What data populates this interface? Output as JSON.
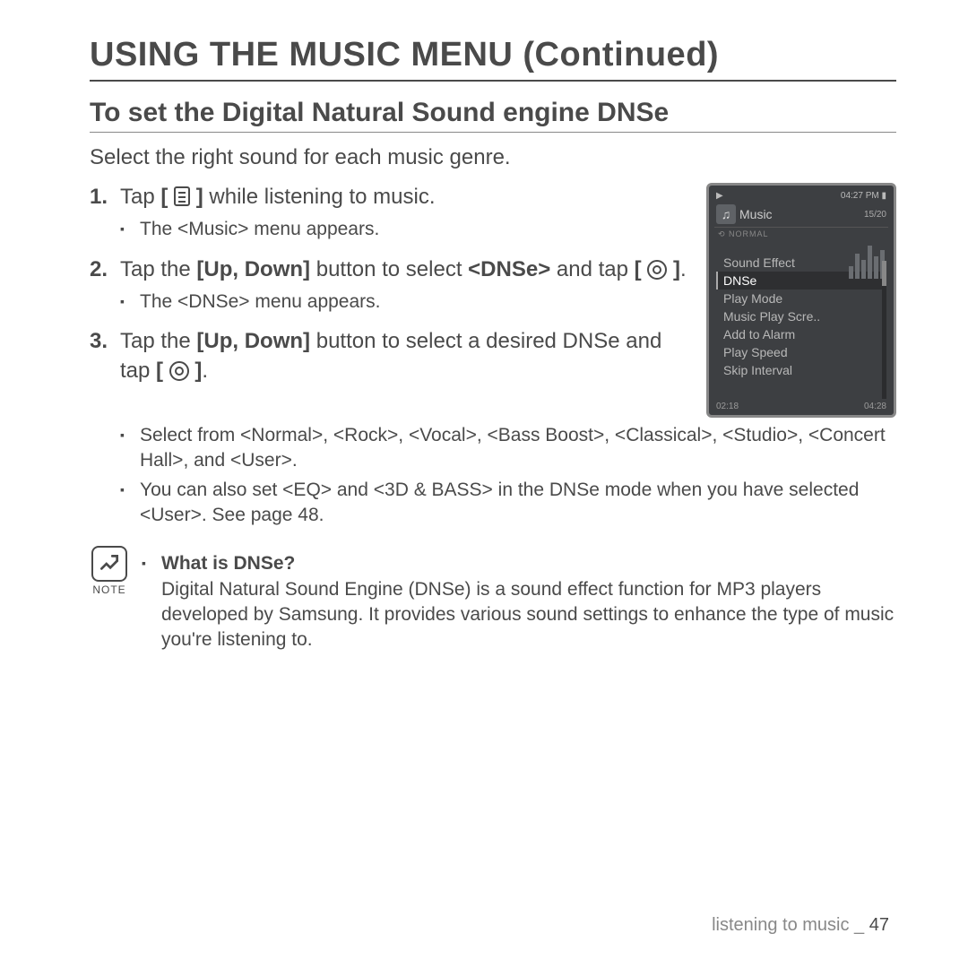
{
  "page_title": "USING THE MUSIC MENU (Continued)",
  "section_title": "To set the Digital Natural Sound engine DNSe",
  "intro": "Select the right sound for each music genre.",
  "steps": [
    {
      "pre": "Tap ",
      "icon": "menu",
      "post": " while listening to music.",
      "subs": [
        "The <Music> menu appears."
      ]
    },
    {
      "pre": "Tap the ",
      "bold1": "[Up, Down]",
      "mid": " button to select ",
      "bold2": "<DNSe>",
      "post2": " and tap ",
      "icon": "select",
      "post3": ".",
      "subs": [
        "The <DNSe> menu appears."
      ]
    },
    {
      "pre": "Tap the ",
      "bold1": "[Up, Down]",
      "mid": " button to select a desired DNSe and tap ",
      "icon": "select",
      "post3": ".",
      "subs": [
        "Select from <Normal>, <Rock>, <Vocal>, <Bass Boost>, <Classical>, <Studio>, <Concert Hall>, and <User>.",
        "You can also set <EQ> and <3D & BASS> in the DNSe mode when you have selected <User>. See page 48."
      ]
    }
  ],
  "note": {
    "label": "NOTE",
    "heading": "What is DNSe?",
    "body": "Digital Natural Sound Engine (DNSe) is a sound effect function for MP3 players developed by Samsung. It provides various sound settings to enhance the type of music you're listening to."
  },
  "device": {
    "status_left": "▶",
    "status_right": "04:27 PM ▮",
    "music_label": "Music",
    "track_count": "15/20",
    "mode": "⟲ NORMAL",
    "menu": [
      "Sound Effect",
      "DNSe",
      "Play Mode",
      "Music Play Scre..",
      "Add to Alarm",
      "Play Speed",
      "Skip Interval"
    ],
    "selected_index": 1,
    "bottom_left": "02:18",
    "bottom_right": "04:28"
  },
  "footer": {
    "section": "listening to music",
    "sep": " _ ",
    "page": "47"
  }
}
